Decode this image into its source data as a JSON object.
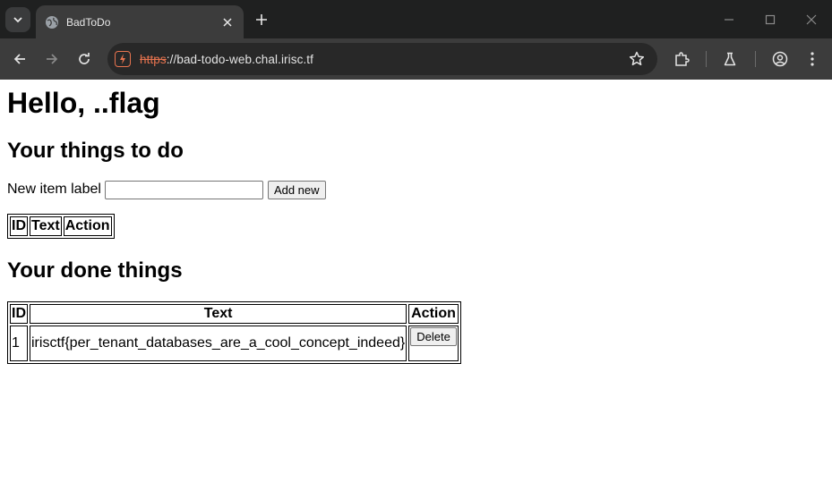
{
  "browser": {
    "tab_title": "BadToDo",
    "url_scheme": "https",
    "url_rest": "://bad-todo-web.chal.irisc.tf"
  },
  "page": {
    "greeting": "Hello, ..flag",
    "todo_heading": "Your things to do",
    "new_item_label": "New item label",
    "new_item_value": "",
    "add_button": "Add new",
    "todo_table": {
      "headers": [
        "ID",
        "Text",
        "Action"
      ],
      "rows": []
    },
    "done_heading": "Your done things",
    "done_table": {
      "headers": [
        "ID",
        "Text",
        "Action"
      ],
      "rows": [
        {
          "id": "1",
          "text": "irisctf{per_tenant_databases_are_a_cool_concept_indeed}",
          "action": "Delete"
        }
      ]
    }
  }
}
